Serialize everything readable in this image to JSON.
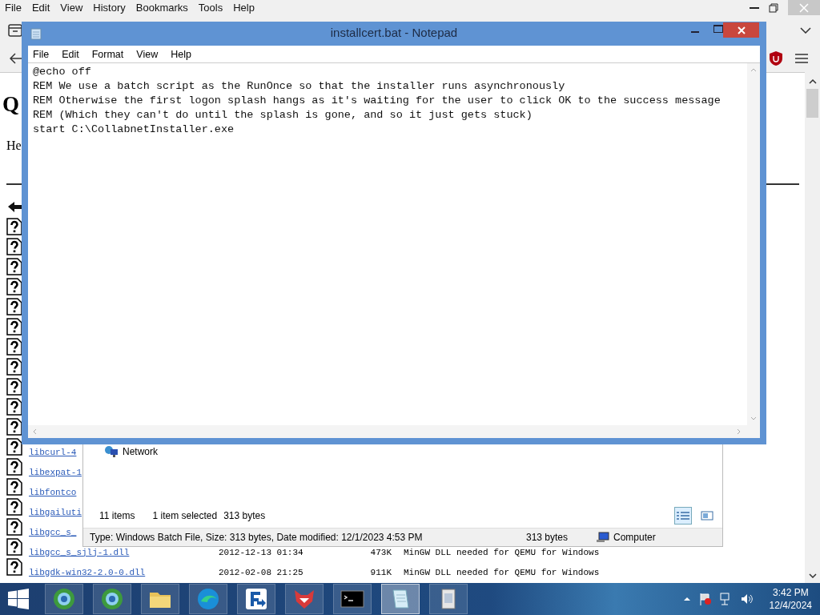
{
  "browser": {
    "menu": [
      "File",
      "Edit",
      "View",
      "History",
      "Bookmarks",
      "Tools",
      "Help"
    ],
    "page": {
      "heading": "Q",
      "intro": "He",
      "rows": [
        {
          "name": "libcurl-4"
        },
        {
          "name": "libexpat-1"
        },
        {
          "name": "libfontco"
        },
        {
          "name": "libgailuti"
        },
        {
          "name": "libgcc_s_"
        },
        {
          "name": "libgcc_s_sjlj-1.dll",
          "date": "2012-12-13 01:34",
          "size": "473K",
          "description": "MinGW DLL needed for QEMU for Windows"
        },
        {
          "name": "libgdk-win32-2.0-0.dll",
          "date": "2012-02-08 21:25",
          "size": "911K",
          "description": "MinGW DLL needed for QEMU for Windows"
        }
      ]
    }
  },
  "explorer": {
    "items": [
      {
        "label": "Network"
      }
    ],
    "status": {
      "count": "11 items",
      "selection": "1 item selected",
      "size": "313 bytes"
    },
    "views": [
      {
        "kind": "details",
        "selected": true
      },
      {
        "kind": "tiles",
        "selected": false
      }
    ],
    "details_bar": {
      "info": "Type: Windows Batch File, Size: 313 bytes, Date modified: 12/1/2023 4:53 PM",
      "size": "313 bytes",
      "location": "Computer"
    }
  },
  "notepad": {
    "title": "installcert.bat - Notepad",
    "menu": [
      "File",
      "Edit",
      "Format",
      "View",
      "Help"
    ],
    "lines": [
      "@echo off",
      "REM We use a batch script as the RunOnce so that the installer runs asynchronously",
      "REM Otherwise the first logon splash hangs as it's waiting for the user to click OK to the success message",
      "REM (Which they can't do until the splash is gone, and so it just gets stuck)",
      "start C:\\CollabnetInstaller.exe"
    ]
  },
  "taskbar": {
    "apps": [
      {
        "kind": "globe",
        "active": false
      },
      {
        "kind": "globe",
        "active": false
      },
      {
        "kind": "folder",
        "active": false
      },
      {
        "kind": "wave",
        "active": false
      },
      {
        "kind": "arrow",
        "active": false
      },
      {
        "kind": "fox",
        "active": false
      },
      {
        "kind": "console",
        "active": false
      },
      {
        "kind": "notepad",
        "active": true
      },
      {
        "kind": "installer",
        "active": false
      }
    ],
    "time": "3:42 PM",
    "date": "12/4/2024"
  }
}
